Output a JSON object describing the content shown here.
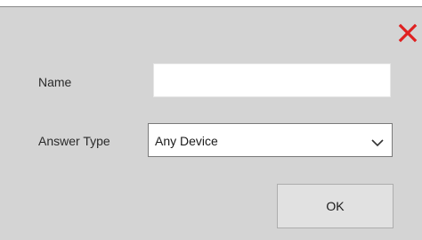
{
  "dialog": {
    "close_icon": "close-x-icon",
    "close_color": "#e02020",
    "fields": {
      "name_label": "Name",
      "name_value": "",
      "answer_type_label": "Answer Type",
      "answer_type_value": "Any Device"
    },
    "ok_label": "OK"
  }
}
